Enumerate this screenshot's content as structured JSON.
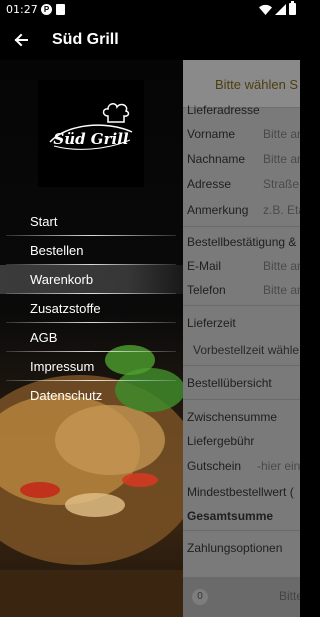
{
  "status_bar": {
    "time": "01:27"
  },
  "app_bar": {
    "title": "Süd Grill"
  },
  "logo": {
    "text": "Süd Grill"
  },
  "menu": {
    "items": [
      {
        "label": "Start"
      },
      {
        "label": "Bestellen"
      },
      {
        "label": "Warenkorb",
        "active": true
      },
      {
        "label": "Zusatzstoffe"
      },
      {
        "label": "AGB"
      },
      {
        "label": "Impressum"
      },
      {
        "label": "Datenschutz"
      }
    ]
  },
  "page": {
    "header": "Bitte wählen S",
    "delivery_address": "Lieferadresse",
    "fields": {
      "vorname": {
        "label": "Vorname",
        "placeholder": "Bitte an"
      },
      "nachname": {
        "label": "Nachname",
        "placeholder": "Bitte an"
      },
      "adresse": {
        "label": "Adresse",
        "placeholder": "Straße,"
      },
      "anmerkung": {
        "label": "Anmerkung",
        "placeholder": "z.B. Eta"
      }
    },
    "confirmation": "Bestellbestätigung &",
    "email": {
      "label": "E-Mail",
      "placeholder": "Bitte an"
    },
    "telefon": {
      "label": "Telefon",
      "placeholder": "Bitte an"
    },
    "lieferzeit": "Lieferzeit",
    "lieferzeit_select": "Vorbestellzeit wähle",
    "overview": "Bestellübersicht",
    "zwischensumme": "Zwischensumme",
    "liefergebuehr": "Liefergebühr",
    "gutschein": {
      "label": "Gutschein",
      "placeholder": "-hier ein"
    },
    "mindestbestellwert": "Mindestbestellwert (",
    "gesamtsumme": "Gesamtsumme",
    "zahlungsoptionen": "Zahlungsoptionen",
    "footer": {
      "count": "0",
      "button": "Bitte"
    }
  },
  "colors": {
    "accent": "#e0a000",
    "drawer_bg": "#000000",
    "overlay": "#7a7a7a"
  }
}
